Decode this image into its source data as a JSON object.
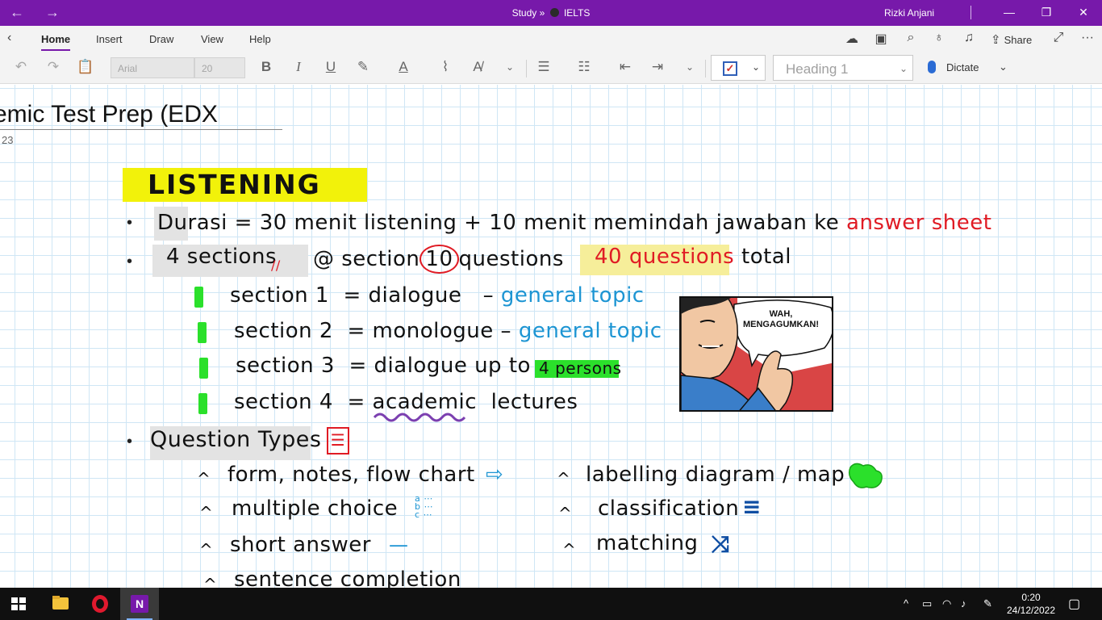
{
  "titlebar": {
    "back_icon": "arrow-left-icon",
    "forward_icon": "arrow-right-icon",
    "notebook": "Study »",
    "section": "IELTS",
    "user": "Rizki Anjani",
    "minimize": "—",
    "restore": "❐",
    "close": "✕"
  },
  "ribbon": {
    "tabs": [
      "Home",
      "Insert",
      "Draw",
      "View",
      "Help"
    ],
    "active_tab": "Home",
    "share_label": "Share",
    "font_name": "Arial",
    "font_size": "20",
    "style": "Heading 1",
    "dictate_label": "Dictate",
    "tools": {
      "undo": "↶",
      "redo": "↷",
      "bold": "B",
      "italic": "I",
      "underline": "U",
      "font_color": "A"
    }
  },
  "page": {
    "title": "emic Test Prep (EDX",
    "date_fragment": "23"
  },
  "notes": {
    "heading": "LISTENING",
    "duration": {
      "text": "Durasi = 30 menit listening + 10 menit memindah jawaban ke",
      "highlight": "answer sheet"
    },
    "sections_line": {
      "count": "4 sections",
      "each_prefix": "@ section",
      "circled": "10",
      "each_suffix": "questions",
      "total_hl": "40 questions",
      "total_word": "total"
    },
    "sections": [
      {
        "label": "section 1",
        "eq": "=",
        "type": "dialogue",
        "dash": "–",
        "topic": "general topic"
      },
      {
        "label": "section 2",
        "eq": "=",
        "type": "monologue",
        "dash": "–",
        "topic": "general topic"
      },
      {
        "label": "section 3",
        "eq": "=",
        "type": "dialogue up to",
        "extra": "4 persons"
      },
      {
        "label": "section 4",
        "eq": "=",
        "type": "academic",
        "extra2": "lectures"
      }
    ],
    "question_types_heading": "Question Types",
    "question_types_left": [
      "form, notes, flow chart",
      "multiple choice",
      "short answer",
      "sentence completion"
    ],
    "question_types_right": [
      "labelling diagram / map",
      "classification",
      "matching"
    ],
    "comic_text": "WAH, MENGAGUMKAN!"
  },
  "taskbar": {
    "apps": [
      "file-explorer-icon",
      "opera-icon",
      "onenote-icon"
    ],
    "onenote_letter": "N",
    "time": "0:20",
    "date": "24/12/2022"
  }
}
